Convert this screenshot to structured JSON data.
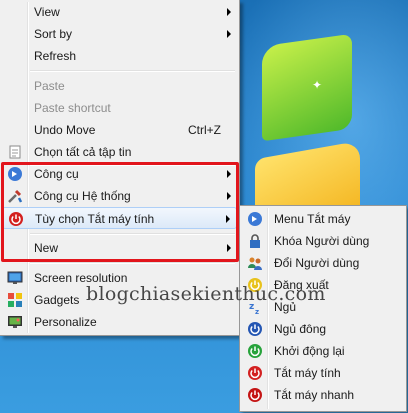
{
  "main_menu": {
    "view": "View",
    "sort_by": "Sort by",
    "refresh": "Refresh",
    "paste": "Paste",
    "paste_shortcut": "Paste shortcut",
    "undo_move": "Undo Move",
    "undo_shortcut": "Ctrl+Z",
    "select_all": "Chọn tất cả tập tin",
    "tools": "Công cụ",
    "system_tools": "Công cụ Hệ thống",
    "shutdown_options": "Tùy chọn Tắt máy tính",
    "new": "New",
    "screen_resolution": "Screen resolution",
    "gadgets": "Gadgets",
    "personalize": "Personalize"
  },
  "sub_menu": {
    "items": [
      {
        "label": "Menu Tắt máy",
        "icon": "arrow-right-icon"
      },
      {
        "label": "Khóa Người dùng",
        "icon": "lock-icon"
      },
      {
        "label": "Đổi Người dùng",
        "icon": "switch-user-icon"
      },
      {
        "label": "Đăng xuất",
        "icon": "logoff-icon"
      },
      {
        "label": "Ngủ",
        "icon": "sleep-icon"
      },
      {
        "label": "Ngủ đông",
        "icon": "hibernate-icon"
      },
      {
        "label": "Khởi động lại",
        "icon": "restart-icon"
      },
      {
        "label": "Tắt máy tính",
        "icon": "shutdown-icon"
      },
      {
        "label": "Tắt máy nhanh",
        "icon": "fast-shutdown-icon"
      }
    ]
  },
  "watermark": "blogchiasekienthuc.com",
  "colors": {
    "highlight_box": "#e2151c",
    "menu_bg": "#f0f0f0",
    "hover_border": "#aecff7"
  }
}
